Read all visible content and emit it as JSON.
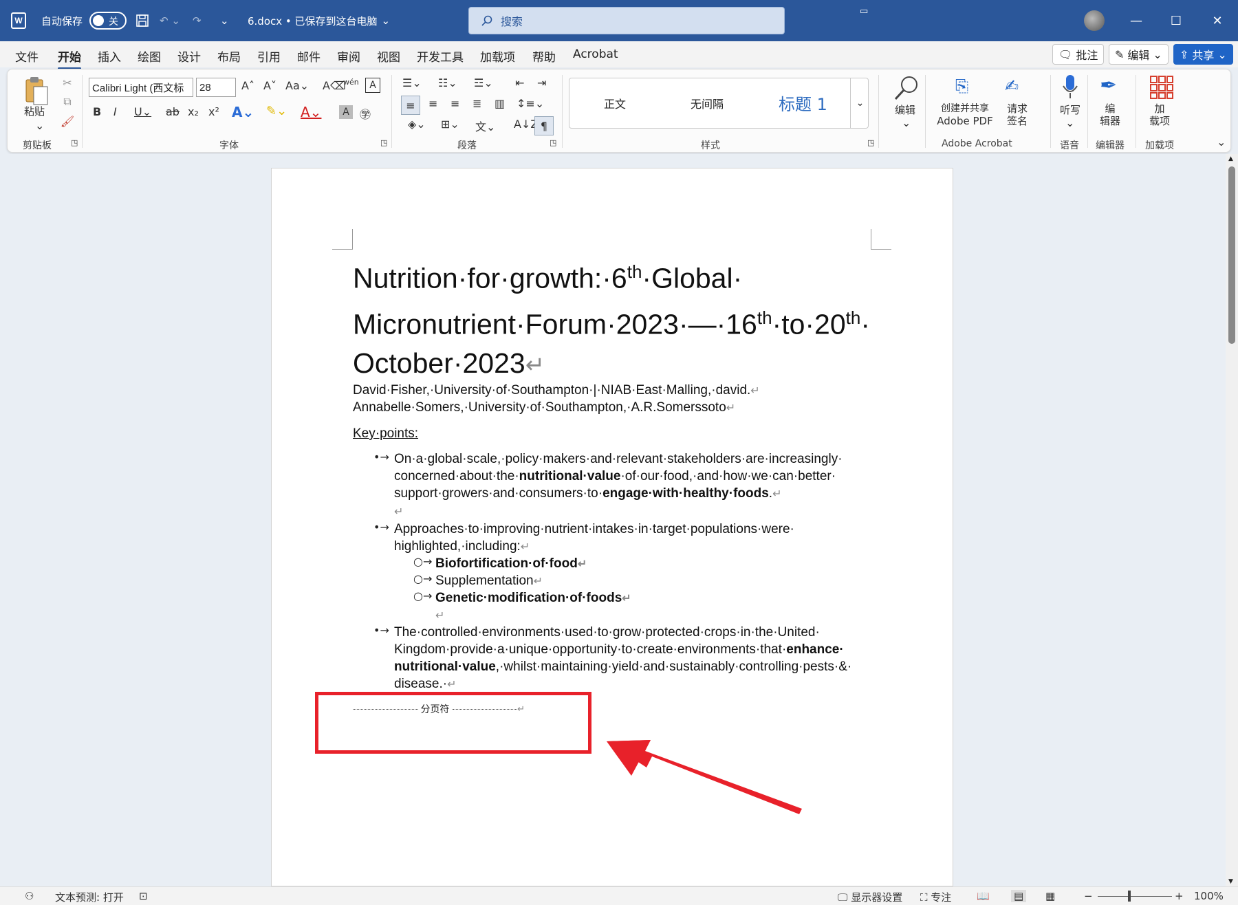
{
  "titlebar": {
    "app_icon": "W",
    "autosave_label": "自动保存",
    "autosave_state": "关",
    "doc_name": "6.docx • 已保存到这台电脑",
    "search_placeholder": "搜索",
    "minimize": "—",
    "maximize": "☐",
    "close": "✕"
  },
  "menu": {
    "tabs": [
      "文件",
      "开始",
      "插入",
      "绘图",
      "设计",
      "布局",
      "引用",
      "邮件",
      "审阅",
      "视图",
      "开发工具",
      "加载项",
      "帮助",
      "Acrobat"
    ],
    "comment": "批注",
    "edit": "编辑",
    "share": "共享"
  },
  "ribbon": {
    "clipboard": {
      "label": "剪贴板",
      "paste": "粘贴"
    },
    "font": {
      "label": "字体",
      "name": "Calibri Light (西文标",
      "size": "28"
    },
    "paragraph": {
      "label": "段落"
    },
    "styles": {
      "label": "样式",
      "items": [
        "正文",
        "无间隔",
        "标题 1"
      ]
    },
    "editing": {
      "label": "编辑"
    },
    "acrobat": {
      "label": "Adobe Acrobat",
      "create_share": "创建并共享",
      "create_share2": "Adobe PDF",
      "request_sign": "请求",
      "request_sign2": "签名"
    },
    "voice": {
      "label": "语音",
      "dictate": "听写"
    },
    "editor": {
      "label": "编辑器",
      "btn1": "编",
      "btn2": "辑器"
    },
    "addins": {
      "label": "加载项",
      "btn1": "加",
      "btn2": "载项"
    }
  },
  "document": {
    "title_parts": [
      "Nutrition·for·growth:·6",
      "th",
      "·Global·",
      "Micronutrient·Forum·2023·—·16",
      "th",
      "·to·20",
      "th",
      "·",
      "October·2023"
    ],
    "authors_line1": "David·Fisher,·University·of·Southampton·|·NIAB·East·Malling,·david.",
    "authors_line2": "Annabelle·Somers,·University·of·Southampton,·A.R.Somerssoto",
    "key_points": "Key·points:",
    "b1_l1": "On·a·global·scale,·policy·makers·and·relevant·stakeholders·are·increasingly·",
    "b1_l2a": "concerned·about·the·",
    "b1_l2b": "nutritional·value",
    "b1_l2c": "·of·our·food,·and·how·we·can·better·",
    "b1_l3a": "support·growers·and·consumers·to·",
    "b1_l3b": "engage·with·healthy·foods",
    "b1_l3c": ".",
    "b2_l1": "Approaches·to·improving·nutrient·intakes·in·target·populations·were·",
    "b2_l2": "highlighted,·including:",
    "sub1": "Biofortification·of·food",
    "sub2": "Supplementation",
    "sub3": "Genetic·modification·of·foods",
    "b3_l1": "The·controlled·environments·used·to·grow·protected·crops·in·the·United·",
    "b3_l2a": "Kingdom·provide·a·unique·opportunity·to·create·environments·that·",
    "b3_l2b": "enhance·",
    "b3_l3a": "nutritional·value",
    "b3_l3b": ",·whilst·maintaining·yield·and·sustainably·controlling·pests·&·",
    "b3_l4": "disease.·",
    "page_break": "分页符",
    "para_mark": "↵"
  },
  "status": {
    "text_prediction": "文本预测: 打开",
    "display_settings": "显示器设置",
    "focus": "专注",
    "zoom": "100%"
  }
}
